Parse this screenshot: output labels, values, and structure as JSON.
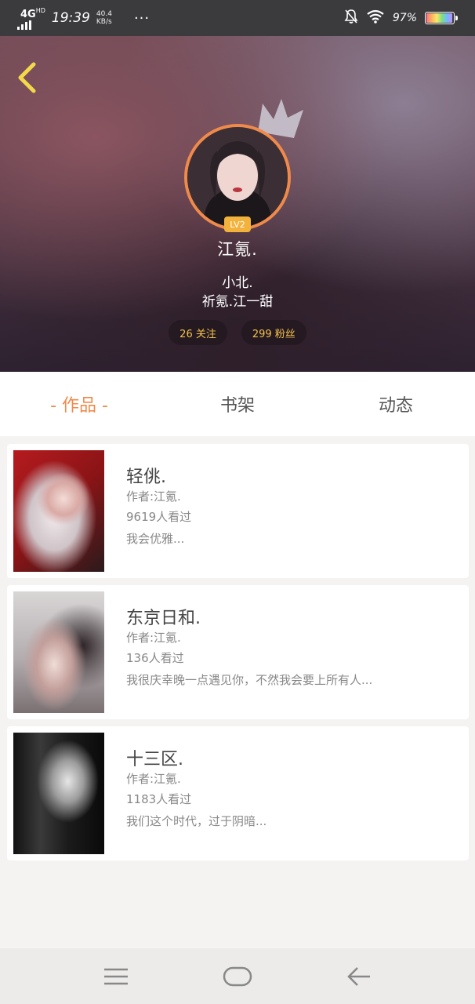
{
  "status_bar": {
    "network": "4G",
    "network_sup": "HD",
    "time": "19:39",
    "speed_value": "40.4",
    "speed_unit": "KB/s",
    "more": "···",
    "battery_pct": "97%",
    "battery_level": 0.97
  },
  "profile": {
    "level": "LV2",
    "username": "江氪.",
    "bio_line1": "小北.",
    "bio_line2": "祈氪.江一甜",
    "following": "26 关注",
    "followers": "299 粉丝",
    "avatar_border_color": "#f08a4b",
    "accent_color": "#f2c14b"
  },
  "tabs": [
    {
      "label": "- 作品 -",
      "active": true
    },
    {
      "label": "书架",
      "active": false
    },
    {
      "label": "动态",
      "active": false
    }
  ],
  "works": [
    {
      "title": "轻佻.",
      "author": "作者:江氪.",
      "views": "9619人看过",
      "desc": "我会优雅..."
    },
    {
      "title": "东京日和.",
      "author": "作者:江氪.",
      "views": "136人看过",
      "desc": "我很庆幸晚一点遇见你，不然我会要上所有人..."
    },
    {
      "title": "十三区.",
      "author": "作者:江氪.",
      "views": "1183人看过",
      "desc": "我们这个时代，过于阴暗..."
    }
  ],
  "colors": {
    "tab_active": "#f08a4b",
    "level_badge": "#f2b23c"
  },
  "nav": {
    "menu_icon": "menu-icon",
    "home_icon": "home-icon",
    "back_icon": "back-arrow-icon"
  }
}
